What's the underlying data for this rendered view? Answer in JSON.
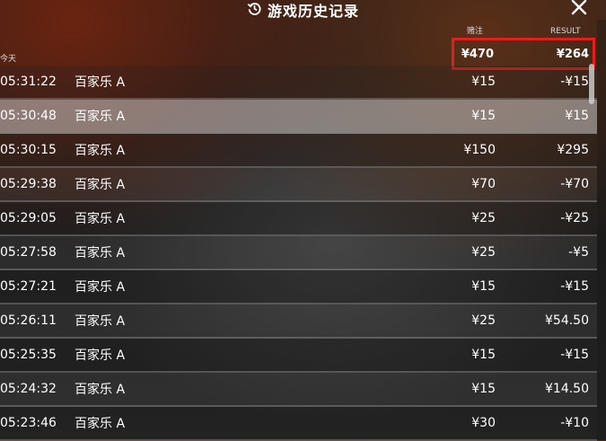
{
  "header": {
    "title": "游戏历史记录",
    "history_icon": "history-clock-icon",
    "close_icon": "close-icon"
  },
  "columns": {
    "bet": "赌注",
    "result": "RESULT"
  },
  "summary": {
    "label": "今天",
    "bet_total": "¥470",
    "result_total": "¥264"
  },
  "colors": {
    "highlight": "#e41e1e"
  },
  "rows": [
    {
      "time": "05:31:22",
      "game": "百家乐 A",
      "bet": "¥15",
      "result": "-¥15"
    },
    {
      "time": "05:30:48",
      "game": "百家乐 A",
      "bet": "¥15",
      "result": "¥15"
    },
    {
      "time": "05:30:15",
      "game": "百家乐 A",
      "bet": "¥150",
      "result": "¥295"
    },
    {
      "time": "05:29:38",
      "game": "百家乐 A",
      "bet": "¥70",
      "result": "-¥70"
    },
    {
      "time": "05:29:05",
      "game": "百家乐 A",
      "bet": "¥25",
      "result": "-¥25"
    },
    {
      "time": "05:27:58",
      "game": "百家乐 A",
      "bet": "¥25",
      "result": "-¥5"
    },
    {
      "time": "05:27:21",
      "game": "百家乐 A",
      "bet": "¥15",
      "result": "-¥15"
    },
    {
      "time": "05:26:11",
      "game": "百家乐 A",
      "bet": "¥25",
      "result": "¥54.50"
    },
    {
      "time": "05:25:35",
      "game": "百家乐 A",
      "bet": "¥15",
      "result": "-¥15"
    },
    {
      "time": "05:24:32",
      "game": "百家乐 A",
      "bet": "¥15",
      "result": "¥14.50"
    },
    {
      "time": "05:23:46",
      "game": "百家乐 A",
      "bet": "¥30",
      "result": "-¥10"
    }
  ]
}
